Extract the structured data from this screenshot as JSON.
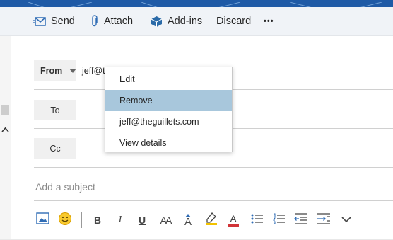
{
  "toolbar": {
    "send_label": "Send",
    "attach_label": "Attach",
    "addins_label": "Add-ins",
    "discard_label": "Discard",
    "more_label": "•••"
  },
  "compose": {
    "from_label": "From",
    "from_value": "jeff@t",
    "to_label": "To",
    "cc_label": "Cc",
    "subject_placeholder": "Add a subject"
  },
  "context_menu": {
    "items": [
      "Edit",
      "Remove",
      "jeff@theguillets.com",
      "View details"
    ],
    "selected": "Remove"
  },
  "format_toolbar": {
    "bold": "B",
    "italic": "I",
    "underline": "U",
    "font_size": "AA",
    "grow_font": "A",
    "font_color": "A",
    "icons": [
      "insert-picture-icon",
      "emoji-icon",
      "bold-icon",
      "italic-icon",
      "underline-icon",
      "font-size-icon",
      "grow-font-icon",
      "highlight-icon",
      "font-color-icon",
      "bullets-icon",
      "numbering-icon",
      "decrease-indent-icon",
      "increase-indent-icon",
      "more-options-icon"
    ]
  },
  "colors": {
    "accent": "#1f5aa6",
    "toolbar_bg": "#f0f3f7",
    "menu_selected": "#a8c7dc",
    "highlight": "#f2c200",
    "font_color": "#d13438",
    "send_icon": "#2f6cb5"
  }
}
